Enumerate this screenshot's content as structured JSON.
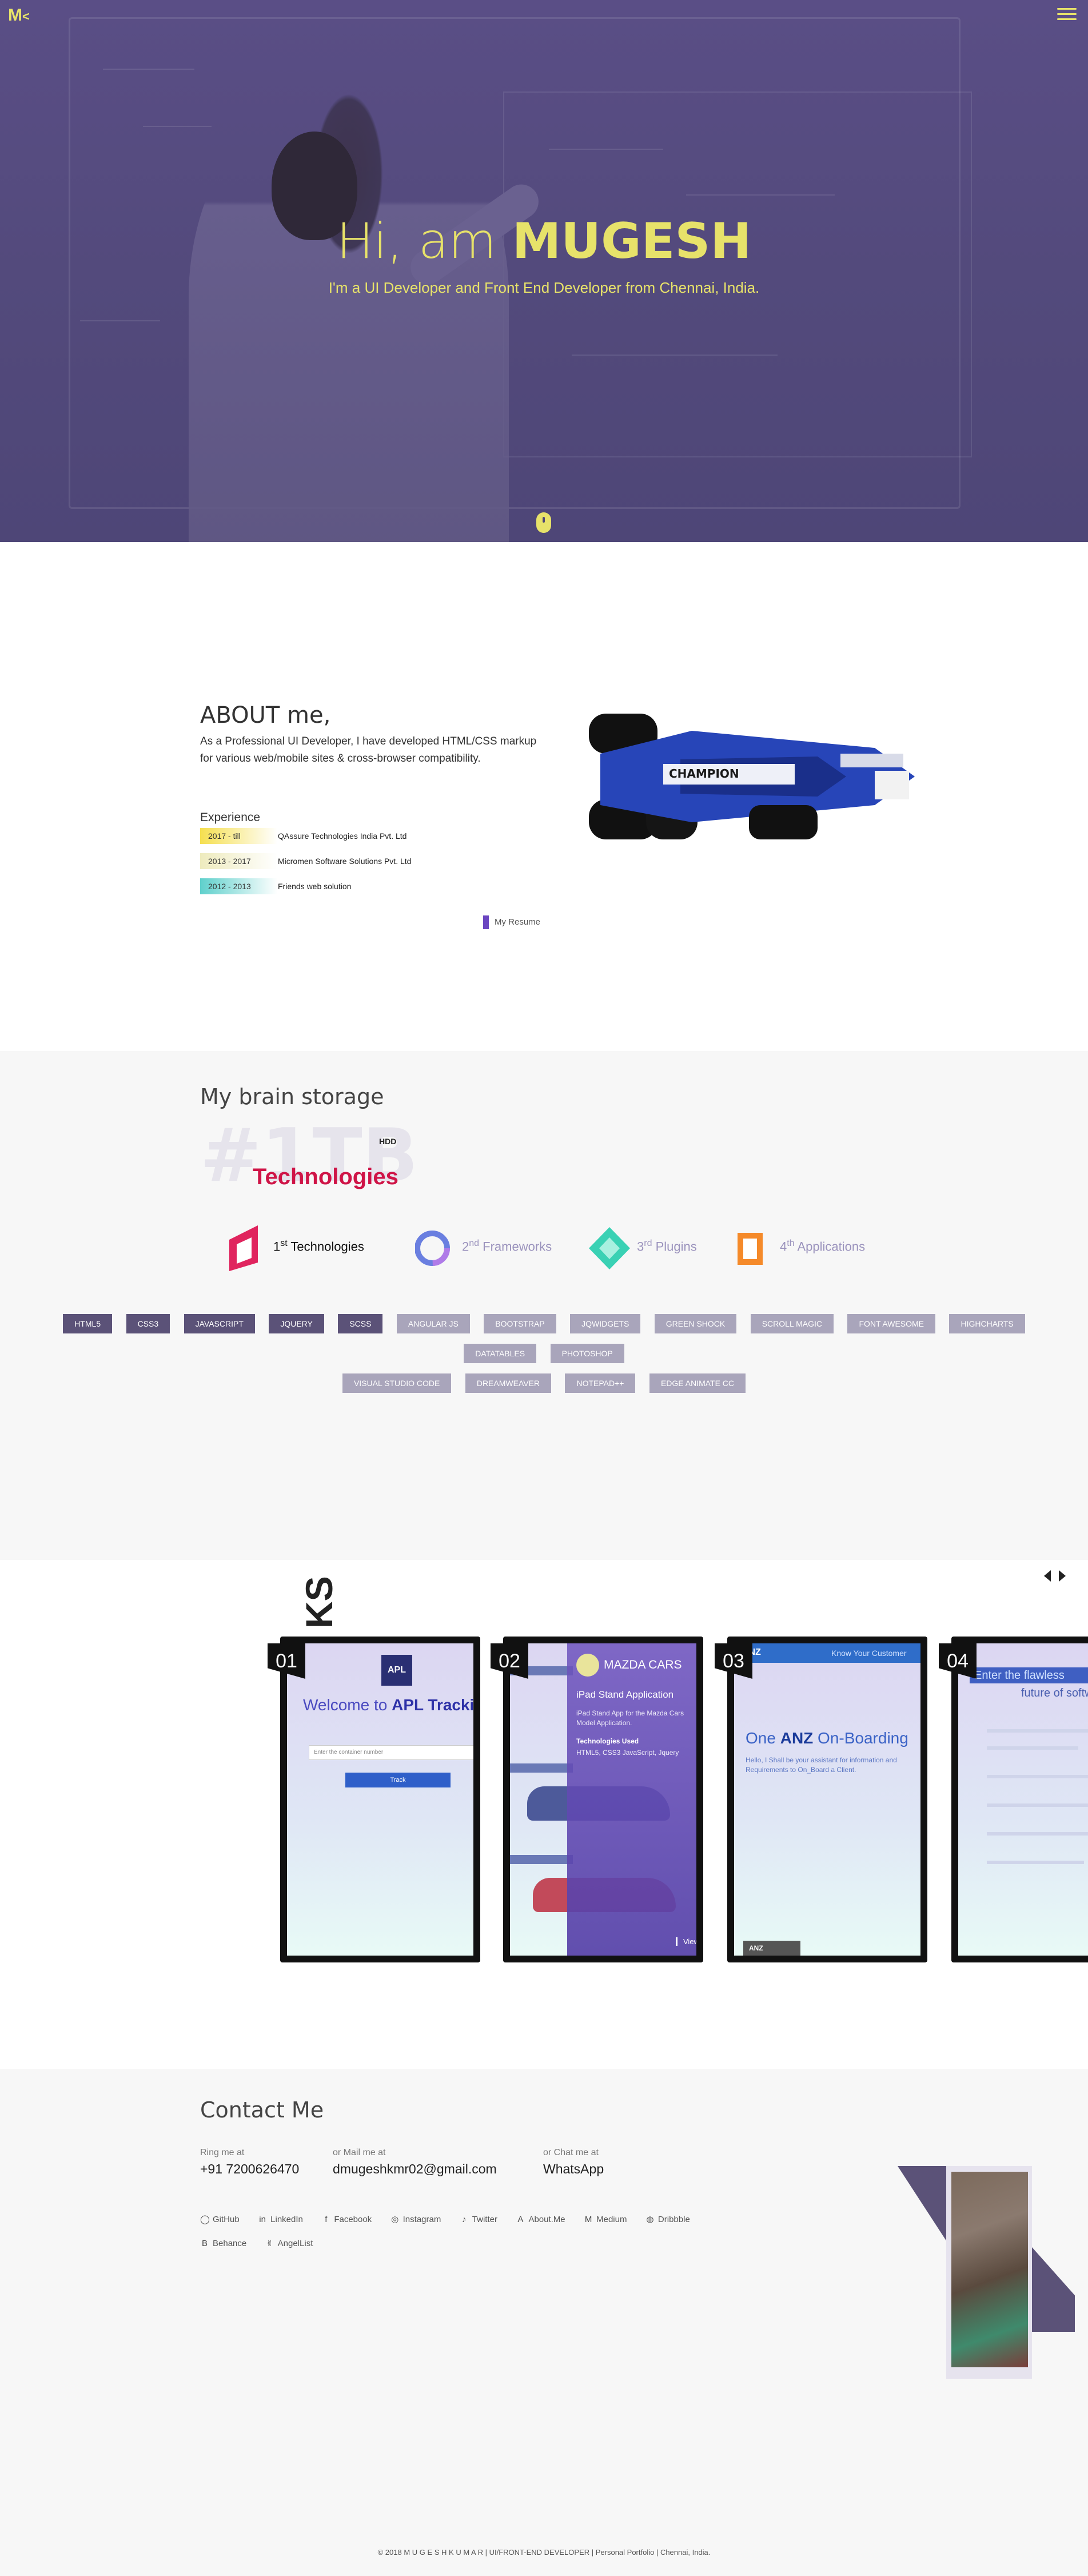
{
  "brand": {
    "logo_text": "M"
  },
  "hero": {
    "greeting": "Hi, am",
    "name": "MUGESH",
    "subtitle": "I'm a UI Developer and Front End Developer from Chennai, India."
  },
  "about": {
    "title": "ABOUT me,",
    "description": "As a Professional UI Developer, I have developed HTML/CSS markup for various web/mobile sites & cross-browser compatibility.",
    "experience_title": "Experience",
    "experience": [
      {
        "years": "2017 - till",
        "company": "QAssure Technologies India Pvt. Ltd",
        "color": "#f5e36b"
      },
      {
        "years": "2013 - 2017",
        "company": "Micromen Software Solutions Pvt. Ltd",
        "color": "#f3f1c8"
      },
      {
        "years": "2012 - 2013",
        "company": "Friends web solution",
        "color": "#7fd8d4"
      }
    ],
    "resume_label": "My Resume",
    "car_text": "CHAMPION"
  },
  "skills": {
    "title": "My brain storage",
    "big": "#1TB",
    "big_suffix": "HDD",
    "heading": "Technologies",
    "categories": [
      {
        "ord": "1",
        "suffix": "st",
        "label": "Technologies",
        "color": "#e0245e",
        "active": true
      },
      {
        "ord": "2",
        "suffix": "nd",
        "label": "Frameworks",
        "color": "#6a7fe0",
        "active": false
      },
      {
        "ord": "3",
        "suffix": "rd",
        "label": "Plugins",
        "color": "#3ad1b4",
        "active": false
      },
      {
        "ord": "4",
        "suffix": "th",
        "label": "Applications",
        "color": "#f58a2a",
        "active": false
      }
    ],
    "tags_dark": [
      "HTML5",
      "CSS3",
      "JAVASCRIPT",
      "JQUERY",
      "SCSS"
    ],
    "tags_light": [
      "ANGULAR JS",
      "BOOTSTRAP",
      "JQWIDGETS",
      "GREEN SHOCK",
      "SCROLL MAGIC",
      "FONT AWESOME",
      "HIGHCHARTS",
      "DATATABLES",
      "PHOTOSHOP",
      "VISUAL STUDIO CODE",
      "DREAMWEAVER",
      "NOTEPAD++",
      "EDGE ANIMATE CC"
    ]
  },
  "works": {
    "title": "KS",
    "cards": [
      {
        "num": "01",
        "logo": "APL",
        "welcome_pre": "Welcome to",
        "welcome_b": "APL Tracking",
        "input_ph": "Enter the container number",
        "button": "Track"
      },
      {
        "num": "02",
        "name": "MAZDA CARS",
        "line1": "iPad Stand Application",
        "line2": "iPad Stand App for the Mazda Cars Model Application.",
        "tech_title": "Technologies Used",
        "tech": "HTML5, CSS3 JavaScript, Jquery",
        "view": "View"
      },
      {
        "num": "03",
        "brand": "ANZ",
        "know": "Know Your Customer",
        "head_pre": "One",
        "head_b": "ANZ",
        "head_post": "On-Boarding",
        "hello": "Hello, I Shall be your assistant for information and Requirements to On_Board a Client.",
        "foot": "ANZ"
      },
      {
        "num": "04",
        "enter": "Enter the flawless",
        "future": "future of softw"
      }
    ]
  },
  "contact": {
    "title": "Contact Me",
    "ring_label": "Ring me at",
    "ring_value": "+91 7200626470",
    "mail_label": "or Mail me at",
    "mail_value": "dmugeshkmr02@gmail.com",
    "chat_label": "or Chat me at",
    "chat_value": "WhatsApp",
    "socials": [
      {
        "icon": "github-icon",
        "glyph": "◯",
        "label": "GitHub"
      },
      {
        "icon": "linkedin-icon",
        "glyph": "in",
        "label": "LinkedIn"
      },
      {
        "icon": "facebook-icon",
        "glyph": "f",
        "label": "Facebook"
      },
      {
        "icon": "instagram-icon",
        "glyph": "◎",
        "label": "Instagram"
      },
      {
        "icon": "twitter-icon",
        "glyph": "♪",
        "label": "Twitter"
      },
      {
        "icon": "aboutme-icon",
        "glyph": "A",
        "label": "About.Me"
      },
      {
        "icon": "medium-icon",
        "glyph": "M",
        "label": "Medium"
      },
      {
        "icon": "dribbble-icon",
        "glyph": "◍",
        "label": "Dribbble"
      },
      {
        "icon": "behance-icon",
        "glyph": "B",
        "label": "Behance"
      },
      {
        "icon": "angellist-icon",
        "glyph": "✌",
        "label": "AngelList"
      }
    ]
  },
  "footer": "© 2018 M U G E S H K U M A R | UI/FRONT-END DEVELOPER | Personal Portfolio | Chennai, India."
}
